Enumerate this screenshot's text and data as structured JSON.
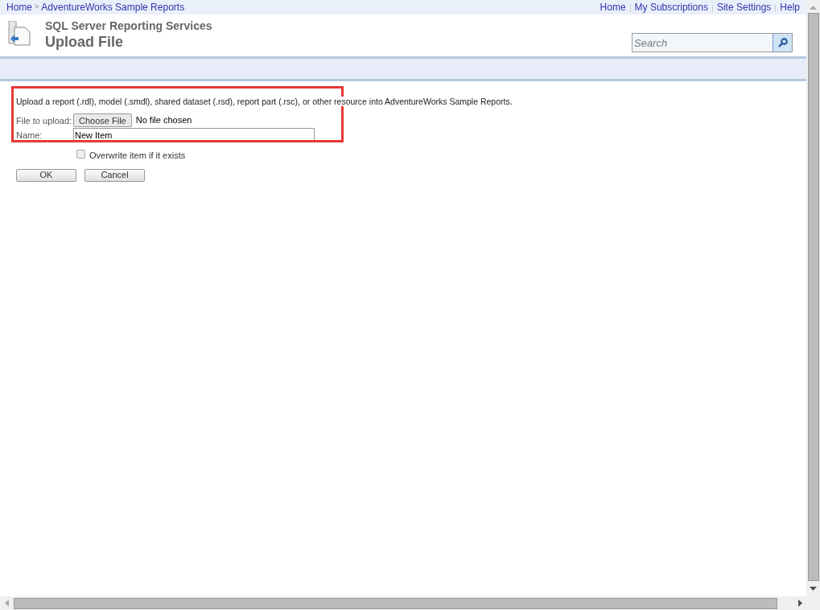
{
  "breadcrumb": [
    {
      "label": "Home"
    },
    {
      "label": "AdventureWorks Sample Reports"
    }
  ],
  "breadcrumb_separator": ">",
  "top_links": [
    {
      "label": "Home"
    },
    {
      "label": "My Subscriptions"
    },
    {
      "label": "Site Settings"
    },
    {
      "label": "Help"
    }
  ],
  "header": {
    "app_title": "SQL Server Reporting Services",
    "page_title": "Upload File"
  },
  "search": {
    "placeholder": "Search"
  },
  "form": {
    "description": "Upload a report (.rdl), model (.smdl), shared dataset (.rsd), report part (.rsc), or other resource into AdventureWorks Sample Reports.",
    "file_label": "File to upload:",
    "choose_button": "Choose File",
    "file_status": "No file chosen",
    "name_label": "Name:",
    "name_value": "New Item",
    "overwrite": {
      "label": "Overwrite item if it exists",
      "checked": false
    }
  },
  "buttons": [
    {
      "label": "OK"
    },
    {
      "label": "Cancel"
    }
  ]
}
